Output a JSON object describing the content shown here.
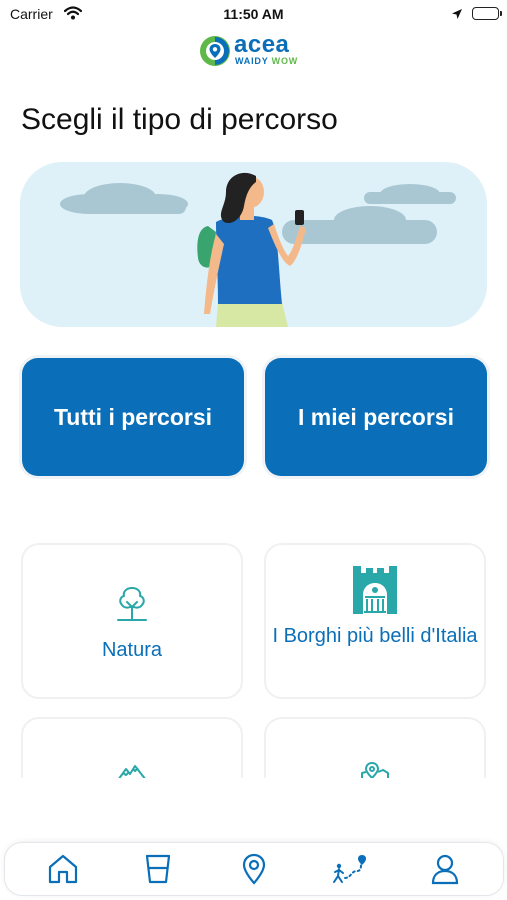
{
  "status_bar": {
    "carrier": "Carrier",
    "time": "11:50 AM"
  },
  "brand": {
    "name": "acea",
    "tagline_part1": "WAIDY",
    "tagline_part2": "WOW",
    "primary_color": "#0a6fb8",
    "accent_color": "#5fb84a"
  },
  "page": {
    "title": "Scegli il tipo di percorso"
  },
  "buttons": {
    "all_routes": "Tutti i percorsi",
    "my_routes": "I miei percorsi"
  },
  "categories": [
    {
      "label": "Natura",
      "icon": "tree-icon"
    },
    {
      "label": "I Borghi più belli d'Italia",
      "icon": "castle-icon"
    },
    {
      "label": "",
      "icon": "mountain-icon"
    },
    {
      "label": "",
      "icon": "map-pin-icon"
    }
  ],
  "tab_bar": [
    {
      "icon": "home-icon"
    },
    {
      "icon": "water-glass-icon"
    },
    {
      "icon": "location-pin-icon"
    },
    {
      "icon": "walking-route-icon"
    },
    {
      "icon": "user-icon"
    }
  ]
}
